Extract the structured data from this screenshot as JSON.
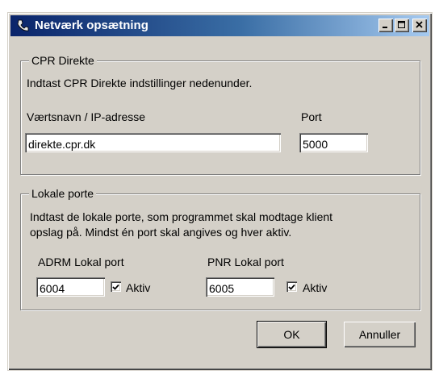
{
  "window": {
    "title": "Netværk opsætning"
  },
  "cpr": {
    "legend": "CPR Direkte",
    "description": "Indtast CPR Direkte indstillinger nedenunder.",
    "host_label": "Værtsnavn / IP-adresse",
    "host_value": "direkte.cpr.dk",
    "port_label": "Port",
    "port_value": "5000"
  },
  "local": {
    "legend": "Lokale porte",
    "description_line1": "Indtast de lokale porte, som programmet skal modtage klient",
    "description_line2": "opslag på. Mindst én port skal angives og hver aktiv.",
    "adrm_label": "ADRM Lokal port",
    "adrm_value": "6004",
    "adrm_active_label": "Aktiv",
    "adrm_active": true,
    "pnr_label": "PNR Lokal port",
    "pnr_value": "6005",
    "pnr_active_label": "Aktiv",
    "pnr_active": true
  },
  "buttons": {
    "ok": "OK",
    "cancel": "Annuller"
  },
  "icons": {
    "app": "telephone-icon",
    "minimize": "minimize-icon",
    "maximize": "maximize-icon",
    "close": "close-icon",
    "check": "checkmark-icon"
  }
}
